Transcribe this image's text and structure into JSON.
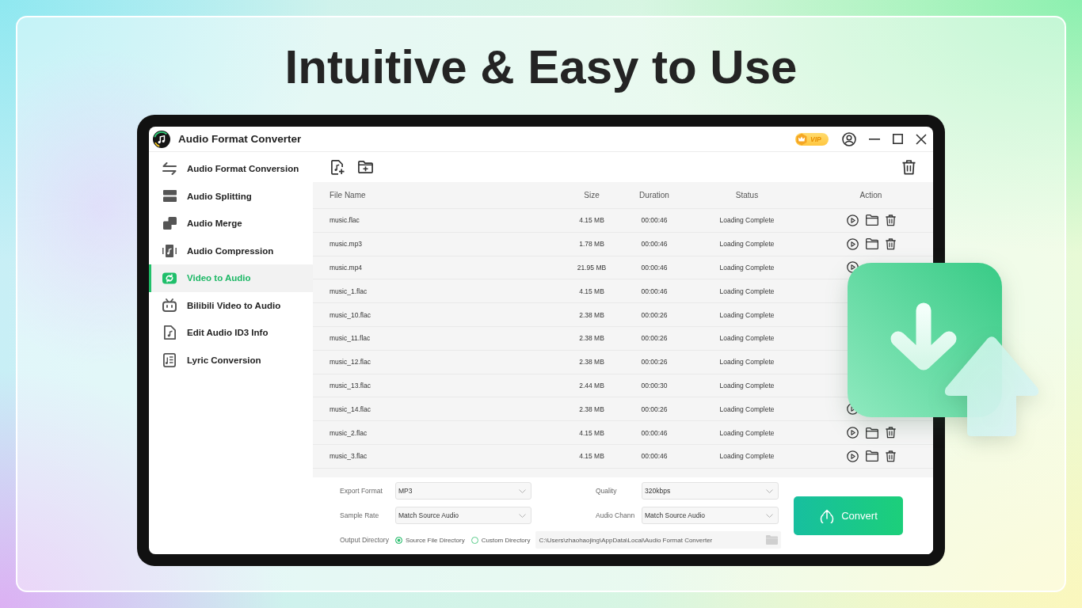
{
  "headline": "Intuitive & Easy to Use",
  "window": {
    "title": "Audio Format Converter",
    "vip_badge": "VIP"
  },
  "sidebar": {
    "items": [
      {
        "label": "Audio Format Conversion",
        "selected": false
      },
      {
        "label": "Audio Splitting",
        "selected": false
      },
      {
        "label": "Audio Merge",
        "selected": false
      },
      {
        "label": "Audio Compression",
        "selected": false
      },
      {
        "label": "Video to Audio",
        "selected": true
      },
      {
        "label": "Bilibili Video to Audio",
        "selected": false
      },
      {
        "label": "Edit Audio ID3 Info",
        "selected": false
      },
      {
        "label": "Lyric Conversion",
        "selected": false
      }
    ]
  },
  "table": {
    "columns": [
      "File Name",
      "Size",
      "Duration",
      "Status",
      "Action"
    ],
    "rows": [
      {
        "file_name": "music.flac",
        "size": "4.15 MB",
        "duration": "00:00:46",
        "status": "Loading Complete"
      },
      {
        "file_name": "music.mp3",
        "size": "1.78 MB",
        "duration": "00:00:46",
        "status": "Loading Complete"
      },
      {
        "file_name": "music.mp4",
        "size": "21.95 MB",
        "duration": "00:00:46",
        "status": "Loading Complete"
      },
      {
        "file_name": "music_1.flac",
        "size": "4.15 MB",
        "duration": "00:00:46",
        "status": "Loading Complete"
      },
      {
        "file_name": "music_10.flac",
        "size": "2.38 MB",
        "duration": "00:00:26",
        "status": "Loading Complete"
      },
      {
        "file_name": "music_11.flac",
        "size": "2.38 MB",
        "duration": "00:00:26",
        "status": "Loading Complete"
      },
      {
        "file_name": "music_12.flac",
        "size": "2.38 MB",
        "duration": "00:00:26",
        "status": "Loading Complete"
      },
      {
        "file_name": "music_13.flac",
        "size": "2.44 MB",
        "duration": "00:00:30",
        "status": "Loading Complete"
      },
      {
        "file_name": "music_14.flac",
        "size": "2.38 MB",
        "duration": "00:00:26",
        "status": "Loading Complete"
      },
      {
        "file_name": "music_2.flac",
        "size": "4.15 MB",
        "duration": "00:00:46",
        "status": "Loading Complete"
      },
      {
        "file_name": "music_3.flac",
        "size": "4.15 MB",
        "duration": "00:00:46",
        "status": "Loading Complete"
      }
    ]
  },
  "settings": {
    "fields": [
      {
        "label": "Export Format",
        "value": "MP3"
      },
      {
        "label": "Quality",
        "value": "320kbps"
      },
      {
        "label": "Sample Rate",
        "value": "Match Source Audio"
      },
      {
        "label": "Audio Chann",
        "value": "Match Source Audio"
      }
    ],
    "output_directory": {
      "label": "Output Directory",
      "options": [
        {
          "label": "Source File Directory",
          "selected": true
        },
        {
          "label": "Custom Directory",
          "selected": false
        }
      ],
      "path": "C:\\Users\\zhaohaojing\\AppData\\Local\\Audio Format Converter"
    },
    "convert_button": "Convert"
  }
}
